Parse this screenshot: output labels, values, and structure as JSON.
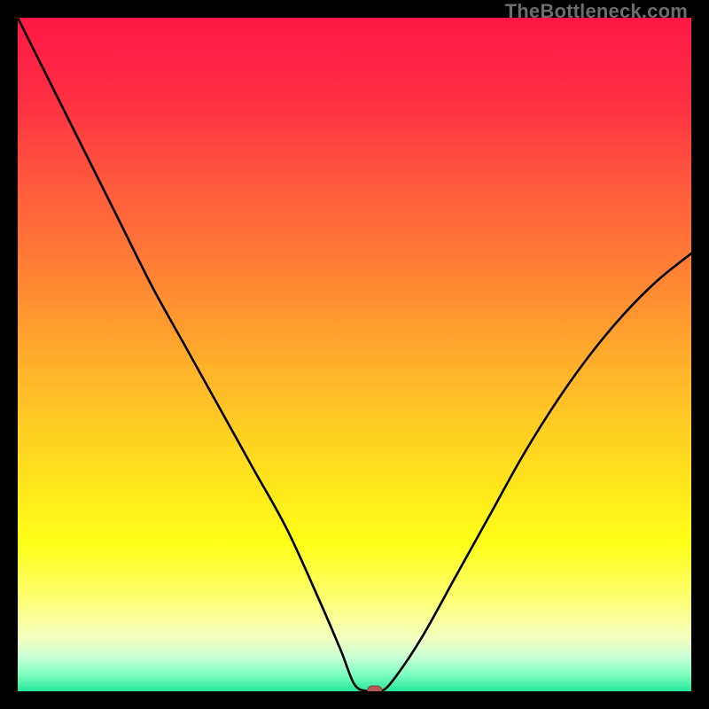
{
  "watermark": "TheBottleneck.com",
  "colors": {
    "frame": "#000000",
    "curve": "#000000",
    "marker_fill": "#b75c55",
    "marker_stroke": "#8a3f39",
    "gradient_stops": [
      {
        "offset": 0.0,
        "color": "#ff1846"
      },
      {
        "offset": 0.12,
        "color": "#ff2e43"
      },
      {
        "offset": 0.25,
        "color": "#ff5a3c"
      },
      {
        "offset": 0.38,
        "color": "#ff8234"
      },
      {
        "offset": 0.52,
        "color": "#ffb22a"
      },
      {
        "offset": 0.65,
        "color": "#ffd91f"
      },
      {
        "offset": 0.78,
        "color": "#ffff18"
      },
      {
        "offset": 0.86,
        "color": "#fdff6e"
      },
      {
        "offset": 0.92,
        "color": "#f4ffc0"
      },
      {
        "offset": 0.95,
        "color": "#c7ffd4"
      },
      {
        "offset": 0.975,
        "color": "#7dffc0"
      },
      {
        "offset": 1.0,
        "color": "#26e69a"
      }
    ]
  },
  "chart_data": {
    "type": "line",
    "title": "",
    "xlabel": "",
    "ylabel": "",
    "xlim": [
      0,
      100
    ],
    "ylim": [
      0,
      100
    ],
    "grid": false,
    "legend": false,
    "x": [
      0,
      5,
      10,
      15,
      20,
      25,
      30,
      35,
      40,
      45,
      48,
      50,
      52,
      54,
      56,
      60,
      65,
      70,
      75,
      80,
      85,
      90,
      95,
      100
    ],
    "values": [
      100,
      90,
      80,
      70,
      60,
      51,
      42,
      33,
      24,
      13,
      6,
      1,
      0,
      0,
      2,
      8,
      17,
      26,
      35,
      43,
      50,
      56,
      61,
      65
    ],
    "minimum_marker": {
      "x": 53,
      "y": 0
    }
  }
}
